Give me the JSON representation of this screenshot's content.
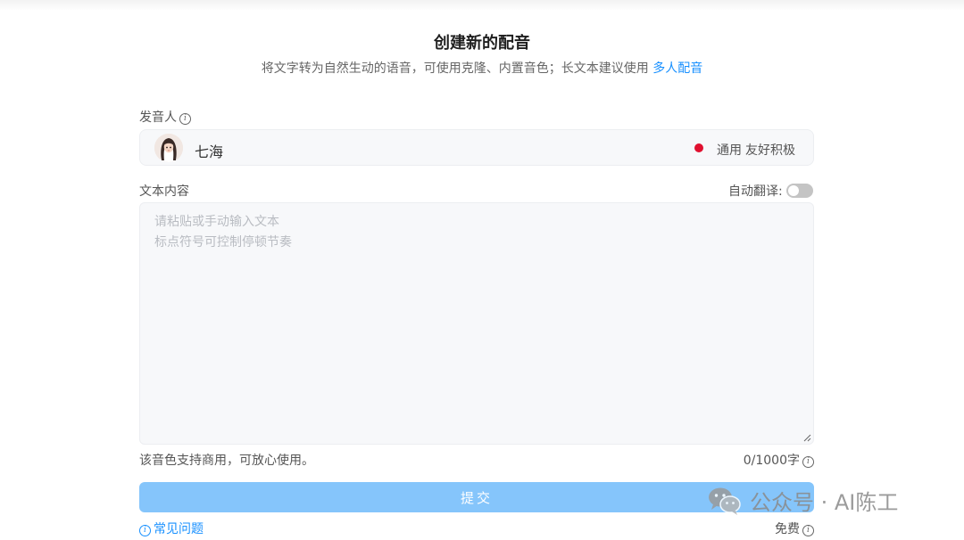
{
  "header": {
    "title": "创建新的配音",
    "subtitle": "将文字转为自然生动的语音，可使用克隆、内置音色；长文本建议使用",
    "subtitle_link": "多人配音"
  },
  "speaker": {
    "label": "发音人",
    "name": "七海",
    "status_color": "#e0102f",
    "tag_1": "通用",
    "tag_2": "友好积极"
  },
  "text_content": {
    "label": "文本内容",
    "auto_translate_label": "自动翻译:",
    "auto_translate_on": false,
    "placeholder": "请粘贴或手动输入文本\n标点符号可控制停顿节奏",
    "value": ""
  },
  "footer": {
    "commercial_note": "该音色支持商用，可放心使用。",
    "char_count": "0/1000字",
    "submit_label": "提交",
    "faq_label": "常见问题",
    "price_label": "免费"
  },
  "watermark": {
    "text": "公众号 · AI陈工"
  },
  "colors": {
    "accent": "#1890ff",
    "submit_bg": "#85c5fb"
  }
}
